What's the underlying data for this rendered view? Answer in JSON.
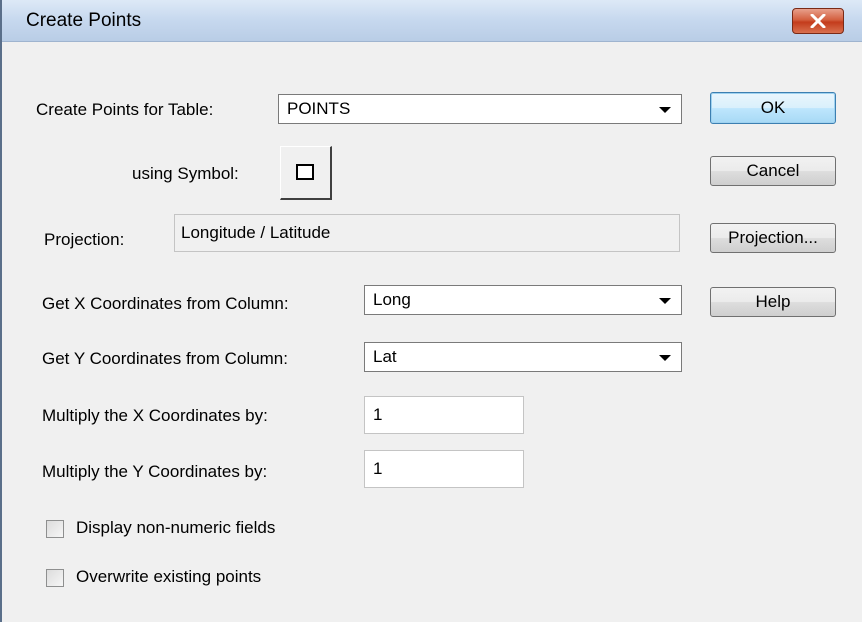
{
  "window": {
    "title": "Create Points",
    "close_icon": "close-icon"
  },
  "form": {
    "table_label": "Create Points for Table:",
    "table_value": "POINTS",
    "symbol_label": "using Symbol:",
    "symbol_icon": "square-symbol-icon",
    "projection_label": "Projection:",
    "projection_value": "Longitude / Latitude",
    "x_column_label": "Get X Coordinates from Column:",
    "x_column_value": "Long",
    "y_column_label": "Get Y Coordinates from Column:",
    "y_column_value": "Lat",
    "x_multiply_label": "Multiply the X Coordinates by:",
    "x_multiply_value": "1",
    "y_multiply_label": "Multiply the Y Coordinates by:",
    "y_multiply_value": "1",
    "display_nonnumeric_label": "Display non-numeric fields",
    "display_nonnumeric_checked": false,
    "overwrite_label": "Overwrite existing points",
    "overwrite_checked": false
  },
  "buttons": {
    "ok": "OK",
    "cancel": "Cancel",
    "projection": "Projection...",
    "help": "Help"
  },
  "colors": {
    "titlebar": "#c6d8ee",
    "close_button": "#d35f3f",
    "dialog_background": "#f0f0f0",
    "default_button_border": "#3c7fb1"
  }
}
